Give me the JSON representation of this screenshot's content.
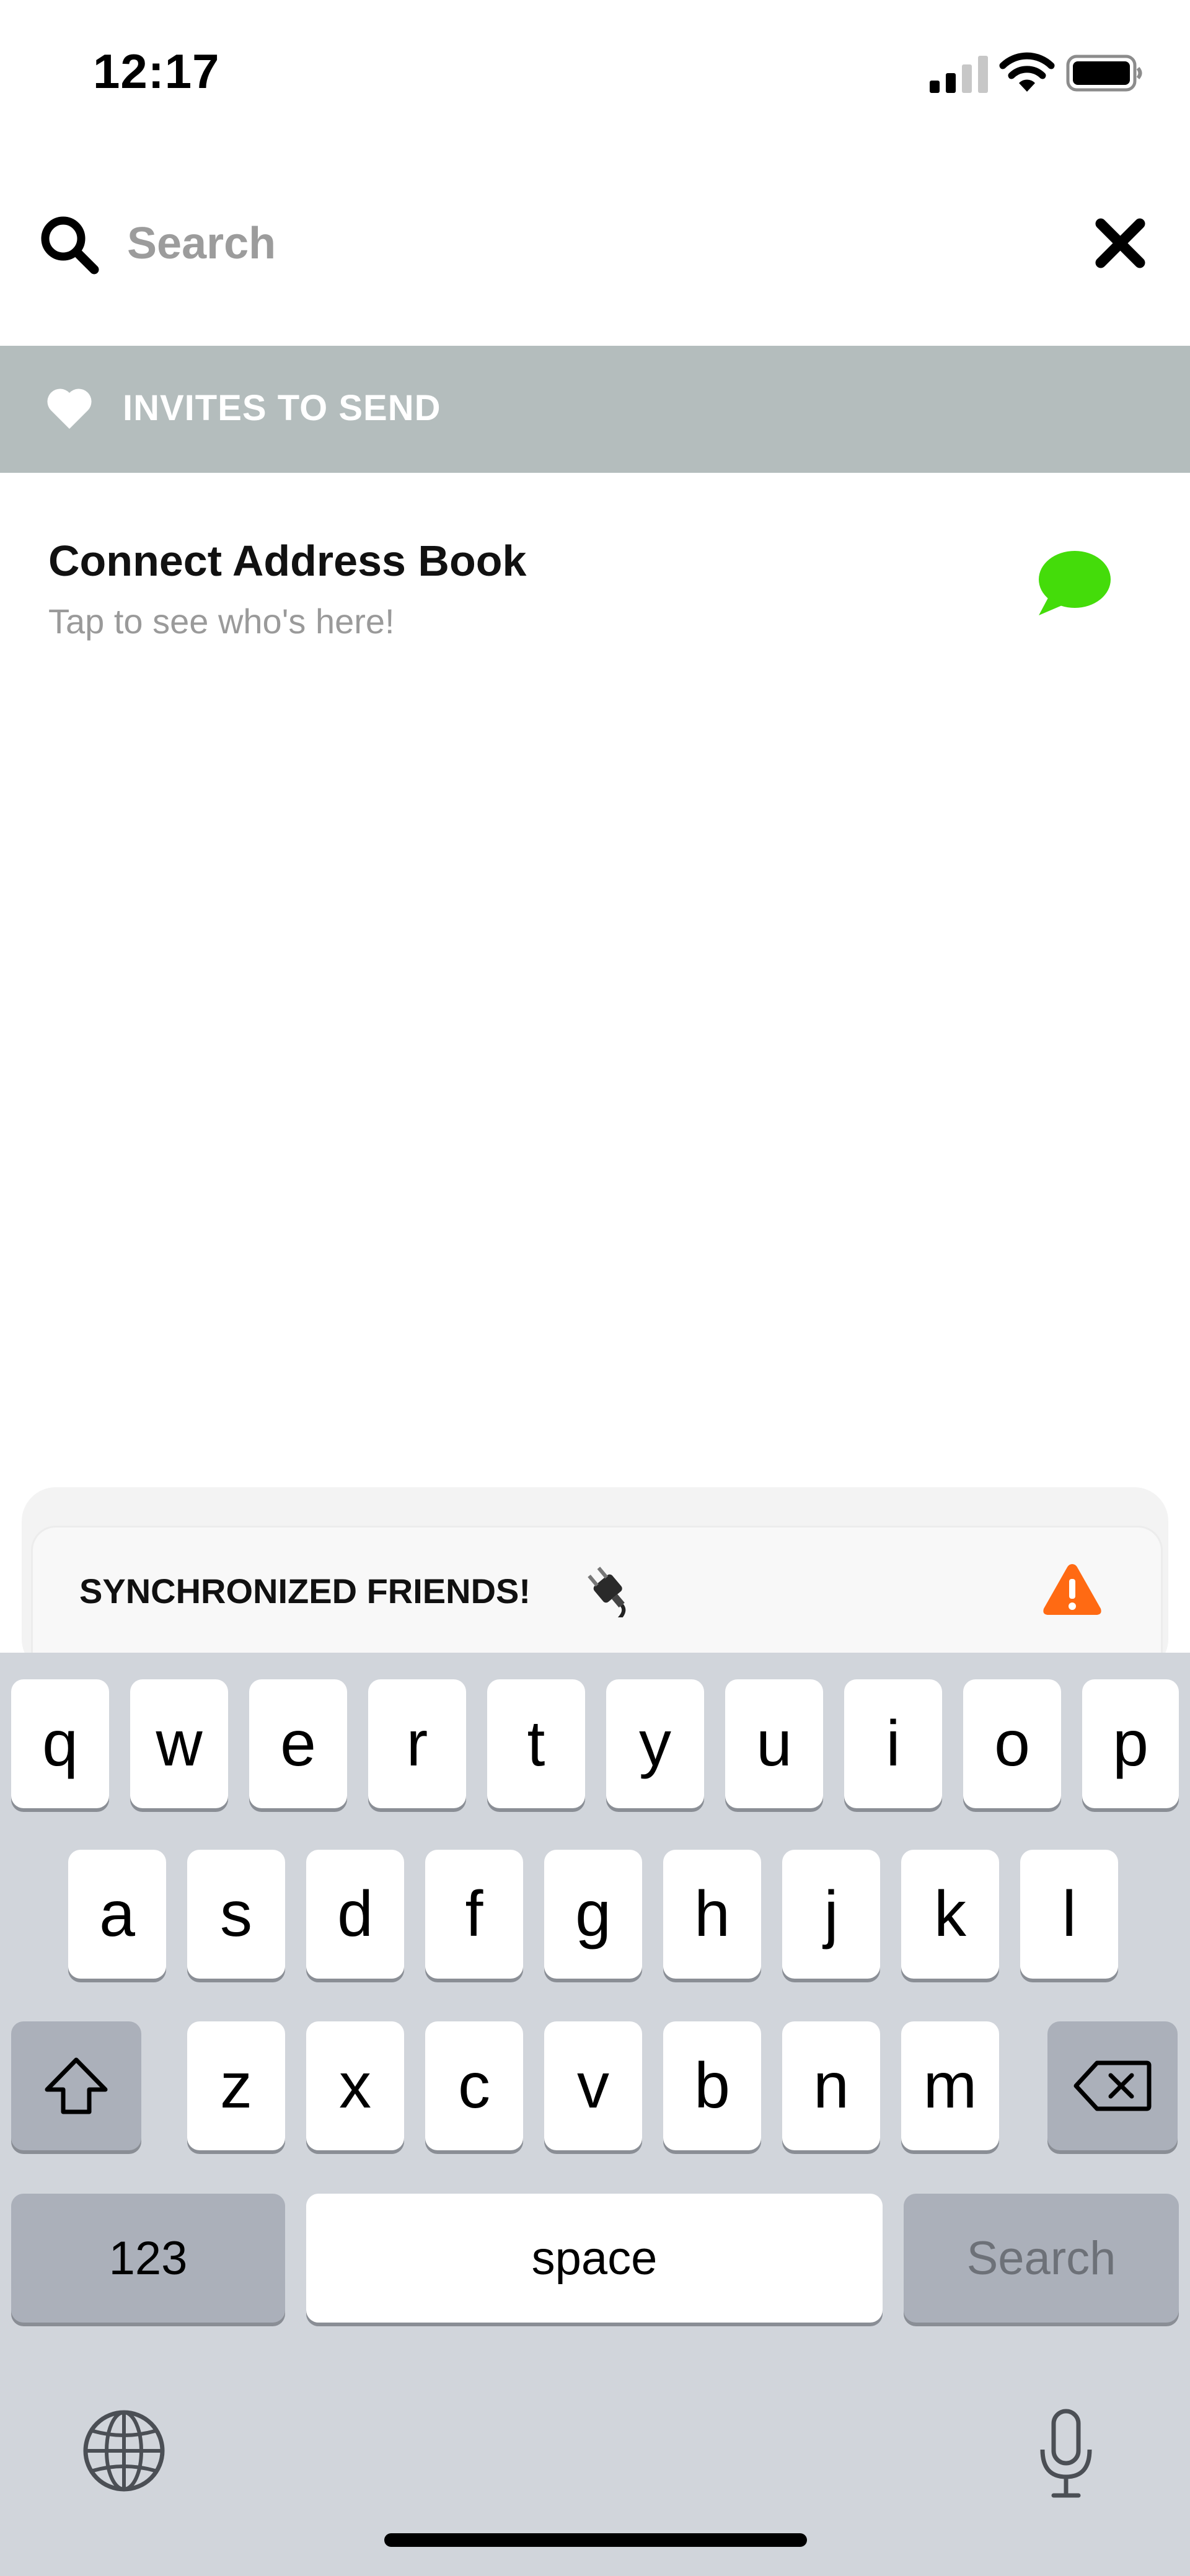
{
  "status_bar": {
    "time": "12:17"
  },
  "search": {
    "placeholder": "Search",
    "value": ""
  },
  "section": {
    "label": "INVITES TO SEND"
  },
  "list": {
    "items": [
      {
        "title": "Connect Address Book",
        "subtitle": "Tap to see who's here!"
      }
    ]
  },
  "toast": {
    "label": "SYNCHRONIZED FRIENDS!"
  },
  "keyboard": {
    "row1": [
      "q",
      "w",
      "e",
      "r",
      "t",
      "y",
      "u",
      "i",
      "o",
      "p"
    ],
    "row2": [
      "a",
      "s",
      "d",
      "f",
      "g",
      "h",
      "j",
      "k",
      "l"
    ],
    "row3": [
      "z",
      "x",
      "c",
      "v",
      "b",
      "n",
      "m"
    ],
    "numbers_label": "123",
    "space_label": "space",
    "search_label": "Search"
  },
  "colors": {
    "section_bg": "#b4bdbd",
    "chat_green": "#44dc0a",
    "warning_orange": "#ff6a13",
    "keyboard_bg": "#d1d5db"
  },
  "icons": [
    "signal-icon",
    "wifi-icon",
    "battery-icon",
    "search-icon",
    "close-icon",
    "heart-icon",
    "chat-bubble-icon",
    "plug-icon",
    "warning-icon",
    "shift-icon",
    "backspace-icon",
    "globe-icon",
    "microphone-icon"
  ]
}
